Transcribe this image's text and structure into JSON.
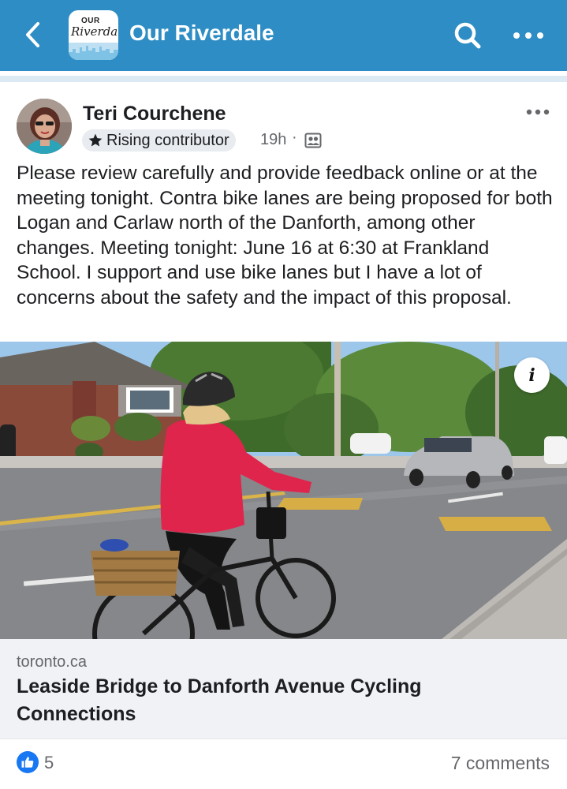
{
  "header": {
    "group_name": "Our Riverdale",
    "logo_text_top": "OUR",
    "logo_text_script": "Riverdale",
    "back_icon": "chevron-left-icon",
    "search_icon": "search-icon",
    "more_icon": "more-horizontal-icon",
    "background_color": "#2d8dc4"
  },
  "post": {
    "author": "Teri Courchene",
    "badge_label": "Rising contributor",
    "badge_icon": "star-icon",
    "time": "19h",
    "separator": "·",
    "audience_icon": "group-audience-icon",
    "menu_icon": "more-horizontal-icon",
    "text": "Please review carefully and provide feedback online or at the meeting tonight. Contra bike lanes are being proposed for both Logan and Carlaw north of the Danforth, among other changes. Meeting tonight: June 16 at 6:30 at Frankland School. I support and use bike lanes but I have a lot of concerns about the safety and the impact of this proposal."
  },
  "link_preview": {
    "image_description_icon": "info-icon",
    "info_glyph": "i",
    "domain": "toronto.ca",
    "title": "Leaside Bridge to Danforth Avenue Cycling Connections"
  },
  "footer": {
    "like_icon": "thumbs-up-icon",
    "like_count": "5",
    "comments": "7 comments",
    "like_color": "#1877f2"
  }
}
